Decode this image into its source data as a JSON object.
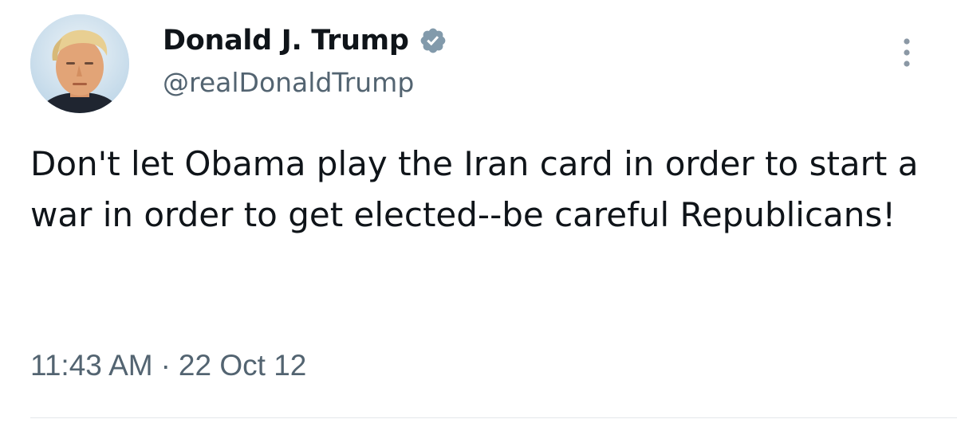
{
  "tweet": {
    "author": {
      "display_name": "Donald J. Trump",
      "handle": "@realDonaldTrump",
      "verified": true,
      "avatar_icon": "profile-photo"
    },
    "text": "Don't let Obama play the Iran card in order to start a war in order to get elected--be careful Republicans!",
    "time": "11:43 AM",
    "separator": "·",
    "date": "22 Oct 12",
    "more_icon": "more-options-vertical-icon"
  },
  "colors": {
    "text_primary": "#0f1419",
    "text_secondary": "#536471",
    "verified_badge": "#829aab",
    "divider": "#e3e7ea",
    "background": "#ffffff"
  }
}
